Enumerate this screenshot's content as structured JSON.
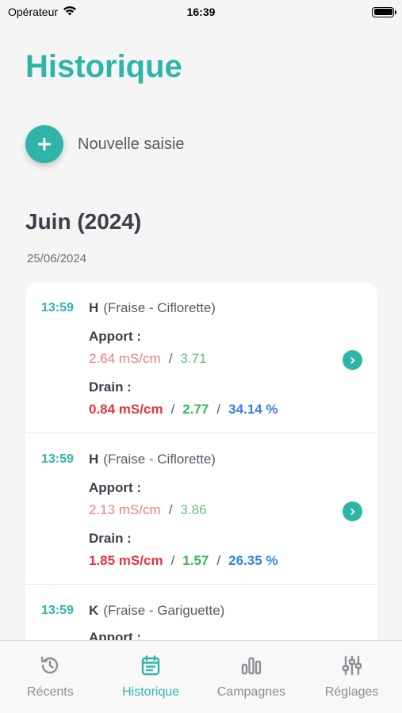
{
  "status_bar": {
    "carrier": "Opérateur",
    "time": "16:39"
  },
  "header": {
    "title": "Historique"
  },
  "new_entry": {
    "label": "Nouvelle saisie"
  },
  "month": {
    "title": "Juin (2024)"
  },
  "date_group": {
    "date": "25/06/2024"
  },
  "entries": [
    {
      "time": "13:59",
      "code": "H",
      "crop": "(Fraise - Ciflorette)",
      "apport_label": "Apport :",
      "apport_ec": "2.64 mS/cm",
      "apport_ph": "3.71",
      "drain_label": "Drain :",
      "drain_ec": "0.84 mS/cm",
      "drain_ph": "2.77",
      "drain_pct": "34.14 %"
    },
    {
      "time": "13:59",
      "code": "H",
      "crop": "(Fraise - Ciflorette)",
      "apport_label": "Apport :",
      "apport_ec": "2.13 mS/cm",
      "apport_ph": "3.86",
      "drain_label": "Drain :",
      "drain_ec": "1.85 mS/cm",
      "drain_ph": "1.57",
      "drain_pct": "26.35 %"
    },
    {
      "time": "13:59",
      "code": "K",
      "crop": "(Fraise - Gariguette)",
      "apport_label": "Apport :"
    }
  ],
  "separator": "/",
  "tabs": [
    {
      "label": "Récents",
      "icon": "history-icon",
      "active": false
    },
    {
      "label": "Historique",
      "icon": "calendar-icon",
      "active": true
    },
    {
      "label": "Campagnes",
      "icon": "bar-chart-icon",
      "active": false
    },
    {
      "label": "Réglages",
      "icon": "sliders-icon",
      "active": false
    }
  ],
  "colors": {
    "accent": "#2fb5a8",
    "apport_ec": "#f07b7b",
    "apport_ph": "#5cc27b",
    "drain_ec": "#e4343f",
    "drain_ph": "#36b85a",
    "drain_pct": "#3b7fe0"
  }
}
